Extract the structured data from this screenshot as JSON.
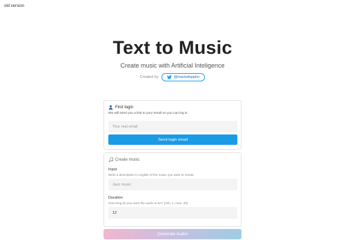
{
  "header": {
    "old_version_link": "old version"
  },
  "hero": {
    "title": "Text to Music",
    "subtitle": "Create music with Artificial Inteligence",
    "credit_label": "Created by",
    "credit_handle": "@mariodoppler"
  },
  "login_card": {
    "title": "First login",
    "description": "We will send you a link to your email so you can log in",
    "email_placeholder": "Your real email",
    "email_value": "",
    "button_label": "Send login email"
  },
  "music_card": {
    "title": "Create music",
    "input_label": "Input",
    "input_help": "Write a description in english of the music you want to create.",
    "input_placeholder": "Jazz music",
    "input_value": "",
    "duration_label": "Duration",
    "duration_help": "How long do you want the audio to be? (min: 1, max: 30)",
    "duration_value": "12"
  },
  "generate_button": {
    "label": "¡Generate Audio!"
  },
  "colors": {
    "accent_blue": "#1a9be6",
    "twitter_blue": "#1da1f2",
    "gradient_start": "#f2b6cf",
    "gradient_end": "#9fcce6"
  },
  "icons": {
    "credit": "twitter-bird-icon",
    "login": "user-icon",
    "music": "music-note-icon"
  }
}
